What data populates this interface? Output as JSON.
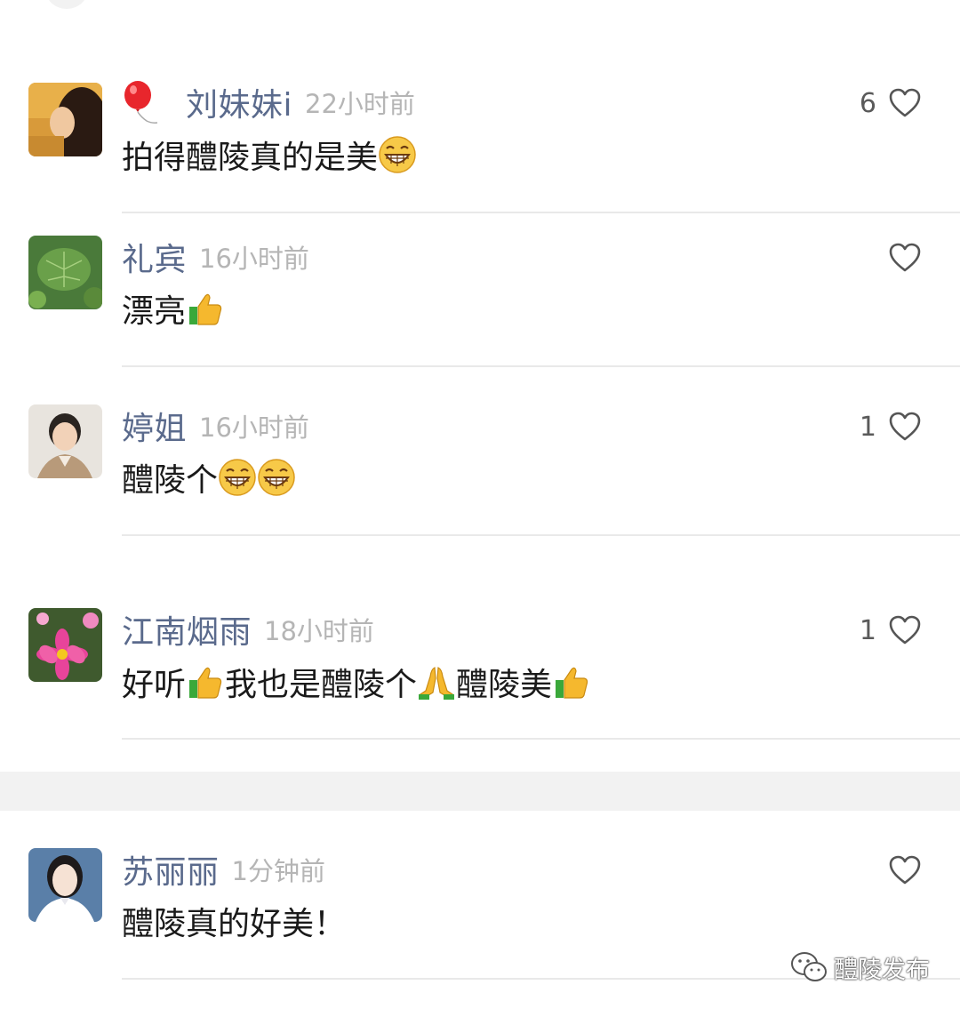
{
  "comments": [
    {
      "username": "刘妹妹i",
      "time": "22小时前",
      "likes": "6",
      "text_segments": [
        "拍得醴陵真的是美"
      ],
      "emojis": [
        "grin-emoji"
      ]
    },
    {
      "username": "礼宾",
      "time": "16小时前",
      "likes": "",
      "text_segments": [
        "漂亮"
      ],
      "emojis": [
        "thumbs-up-emoji"
      ]
    },
    {
      "username": "婷姐",
      "time": "16小时前",
      "likes": "1",
      "text_segments": [
        "醴陵个"
      ],
      "emojis": [
        "grin-emoji",
        "grin-emoji"
      ]
    },
    {
      "username": "江南烟雨",
      "time": "18小时前",
      "likes": "1",
      "text_segments": [
        "好听",
        "我也是醴陵个",
        "醴陵美"
      ],
      "emojis": [
        "thumbs-up-emoji",
        "pray-emoji",
        "thumbs-up-emoji"
      ]
    },
    {
      "username": "苏丽丽",
      "time": "1分钟前",
      "likes": "",
      "text_segments": [
        "醴陵真的好美！"
      ],
      "emojis": []
    }
  ],
  "watermark": {
    "text": "醴陵发布",
    "icon": "wechat-icon"
  },
  "colors": {
    "username": "#5a6a8c",
    "time": "#b5b5b5",
    "text": "#1a1a1a",
    "divider": "#e9e9e9",
    "section_gap": "#f2f2f2"
  }
}
